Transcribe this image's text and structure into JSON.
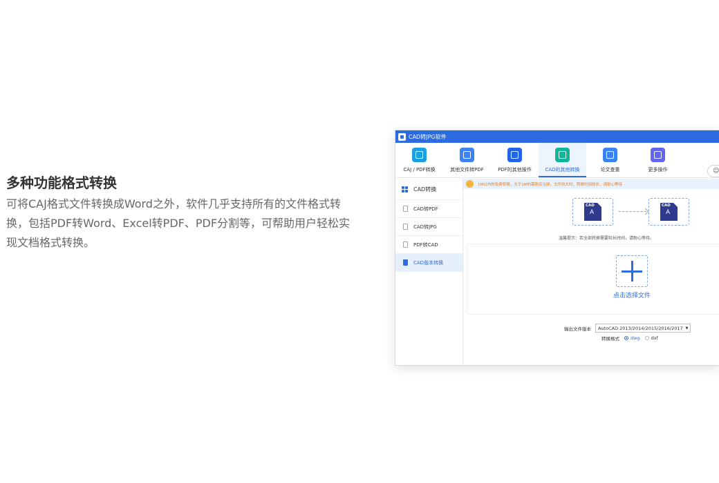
{
  "feature": {
    "title": "多种功能格式转换",
    "description": "可将CAJ格式文件转换成Word之外，软件几乎支持所有的文件格式转换，包括PDF转Word、Excel转PDF、PDF分割等，可帮助用户轻松实现文档格式转换。"
  },
  "app": {
    "window_title": "CAD转JPG软件",
    "toolbar": [
      {
        "label": "CAJ / PDF转换",
        "icon": "pdf-convert-icon",
        "color": "#1a9fe0"
      },
      {
        "label": "其他文件转PDF",
        "icon": "folder-icon",
        "color": "#3b82f6"
      },
      {
        "label": "PDF的其他操作",
        "icon": "refresh-icon",
        "color": "#2563eb"
      },
      {
        "label": "CAD的其他转换",
        "icon": "cad-image-icon",
        "color": "#10b59a"
      },
      {
        "label": "论文查重",
        "icon": "search-icon",
        "color": "#3b82f6"
      },
      {
        "label": "更多操作",
        "icon": "gear-icon",
        "color": "#6366f1"
      }
    ],
    "active_tab": "CAD的其他转换",
    "sidebar": {
      "items": [
        {
          "label": "CAD转换",
          "icon": "grid-icon"
        },
        {
          "label": "CAD转PDF",
          "icon": "pdf-file-icon"
        },
        {
          "label": "CAD转JPG",
          "icon": "image-file-icon"
        },
        {
          "label": "PDF转CAD",
          "icon": "pdf-file-icon"
        },
        {
          "label": "CAD版本转换",
          "icon": "cad-version-icon"
        }
      ],
      "active_item": "CAD版本转换"
    },
    "notice": "1M以内的免费转换，大于1M的需购买注册，文件较大时，转换时间较长，请耐心等待",
    "flow": {
      "source_tag": "CAD",
      "target_tag": "CAD",
      "glyph": "A"
    },
    "tip": "温馨提示：若全部转换需要较长时间，请耐心等待。",
    "select_files": "点击选择文件",
    "output": {
      "label": "输出文件版本",
      "selected_version": "AutoCAD 2013/2014/2015/2016/2017"
    },
    "format": {
      "label": "转换格式",
      "options": [
        "dwg",
        "dxf"
      ],
      "selected": "dwg"
    },
    "accent_color": "#2d6be0"
  }
}
